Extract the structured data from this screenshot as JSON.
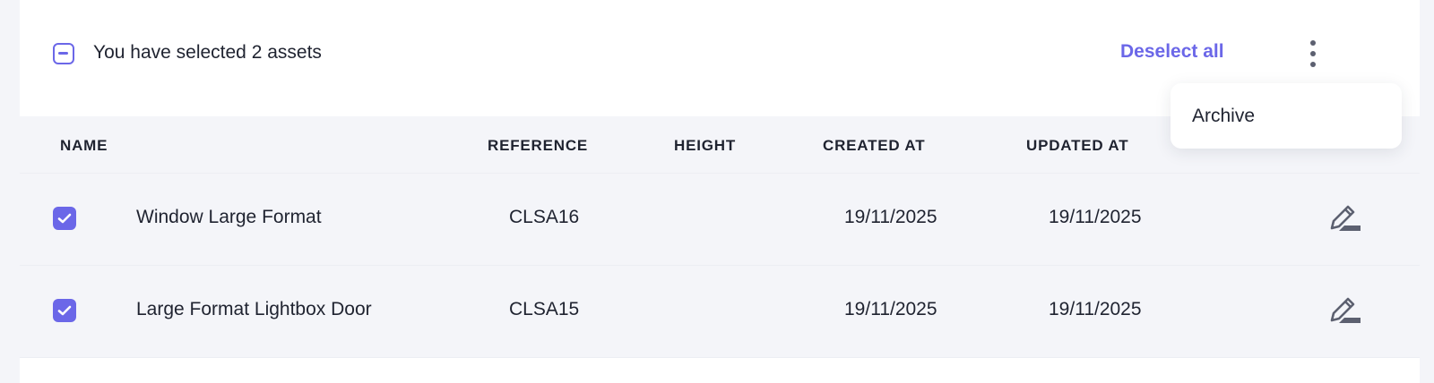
{
  "selection_bar": {
    "message": "You have selected 2 assets",
    "deselect_label": "Deselect all",
    "more_icon": "kebab-vertical-icon"
  },
  "dropdown_menu": {
    "items": [
      {
        "label": "Archive"
      }
    ]
  },
  "table": {
    "columns": {
      "name": "NAME",
      "reference": "REFERENCE",
      "height": "HEIGHT",
      "created_at": "CREATED AT",
      "updated_at": "UPDATED AT"
    },
    "rows": [
      {
        "checked": true,
        "name": "Window Large Format",
        "reference": "CLSA16",
        "height": "",
        "created_at": "19/11/2025",
        "updated_at": "19/11/2025",
        "action_icon": "edit-pencil-icon"
      },
      {
        "checked": true,
        "name": "Large Format Lightbox Door",
        "reference": "CLSA15",
        "height": "",
        "created_at": "19/11/2025",
        "updated_at": "19/11/2025",
        "action_icon": "edit-pencil-icon"
      }
    ]
  },
  "colors": {
    "accent": "#6b67e8",
    "text": "#1f2330",
    "row_background": "#f4f5f9",
    "icon_gray": "#5c6070"
  }
}
